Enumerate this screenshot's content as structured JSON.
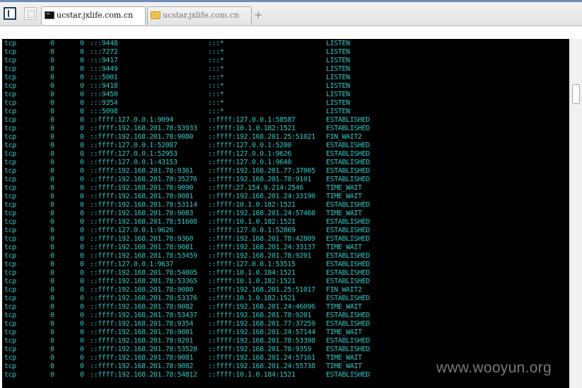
{
  "tabs": [
    {
      "label": "ucstar.jxlife.com.cn",
      "icon": "terminal-icon",
      "active": true
    },
    {
      "label": "ucstar.jxlife.com.cn",
      "icon": "folder-icon",
      "active": false
    }
  ],
  "new_tab_symbol": "+",
  "terminal": {
    "rows": [
      [
        "tcp",
        "0",
        "0",
        ":::9448",
        ":::*",
        "LISTEN"
      ],
      [
        "tcp",
        "0",
        "0",
        ":::7272",
        ":::*",
        "LISTEN"
      ],
      [
        "tcp",
        "0",
        "0",
        ":::9417",
        ":::*",
        "LISTEN"
      ],
      [
        "tcp",
        "0",
        "0",
        ":::9449",
        ":::*",
        "LISTEN"
      ],
      [
        "tcp",
        "0",
        "0",
        ":::5001",
        ":::*",
        "LISTEN"
      ],
      [
        "tcp",
        "0",
        "0",
        ":::9418",
        ":::*",
        "LISTEN"
      ],
      [
        "tcp",
        "0",
        "0",
        ":::9450",
        ":::*",
        "LISTEN"
      ],
      [
        "tcp",
        "0",
        "0",
        ":::9354",
        ":::*",
        "LISTEN"
      ],
      [
        "tcp",
        "0",
        "0",
        ":::5098",
        ":::*",
        "LISTEN"
      ],
      [
        "tcp",
        "0",
        "0",
        "::ffff:127.0.0.1:9094",
        "::ffff:127.0.0.1:58587",
        "ESTABLISHED"
      ],
      [
        "tcp",
        "0",
        "0",
        "::ffff:192.168.201.78:53933",
        "::ffff:10.1.0.182:1521",
        "ESTABLISHED"
      ],
      [
        "tcp",
        "0",
        "0",
        "::ffff:192.168.201.78:9080",
        "::ffff:192.168.201.25:51021",
        "FIN_WAIT2"
      ],
      [
        "tcp",
        "0",
        "0",
        "::ffff:127.0.0.1:52087",
        "::ffff:127.0.0.1:5200",
        "ESTABLISHED"
      ],
      [
        "tcp",
        "0",
        "0",
        "::ffff:127.0.0.1:52953",
        "::ffff:127.0.0.1:9626",
        "ESTABLISHED"
      ],
      [
        "tcp",
        "0",
        "0",
        "::ffff:127.0.0.1:43153",
        "::ffff:127.0.0.1:9640",
        "ESTABLISHED"
      ],
      [
        "tcp",
        "0",
        "0",
        "::ffff:192.168.201.78:9361",
        "::ffff:192.168.201.77:37005",
        "ESTABLISHED"
      ],
      [
        "tcp",
        "0",
        "0",
        "::ffff:192.168.201.78:35276",
        "::ffff:192.168.201.78:9101",
        "ESTABLISHED"
      ],
      [
        "tcp",
        "0",
        "0",
        "::ffff:192.168.201.78:9090",
        "::ffff:27.154.9.214:2546",
        "TIME_WAIT"
      ],
      [
        "tcp",
        "0",
        "0",
        "::ffff:192.168.201.78:9081",
        "::ffff:192.168.201.24:33190",
        "TIME_WAIT"
      ],
      [
        "tcp",
        "0",
        "0",
        "::ffff:192.168.201.78:53114",
        "::ffff:10.1.0.182:1521",
        "ESTABLISHED"
      ],
      [
        "tcp",
        "0",
        "0",
        "::ffff:192.168.201.78:9083",
        "::ffff:192.168.201.24:57468",
        "TIME_WAIT"
      ],
      [
        "tcp",
        "0",
        "0",
        "::ffff:192.168.201.78:51608",
        "::ffff:10.1.0.182:1521",
        "ESTABLISHED"
      ],
      [
        "tcp",
        "0",
        "0",
        "::ffff:127.0.0.1:9626",
        "::ffff:127.0.0.1:52869",
        "ESTABLISHED"
      ],
      [
        "tcp",
        "0",
        "0",
        "::ffff:192.168.201.78:9360",
        "::ffff:192.168.201.78:42809",
        "ESTABLISHED"
      ],
      [
        "tcp",
        "0",
        "0",
        "::ffff:192.168.201.78:9081",
        "::ffff:192.168.201.24:33137",
        "TIME_WAIT"
      ],
      [
        "tcp",
        "0",
        "0",
        "::ffff:192.168.201.78:53459",
        "::ffff:192.168.201.78:9201",
        "ESTABLISHED"
      ],
      [
        "tcp",
        "0",
        "0",
        "::ffff:127.0.0.1:9637",
        "::ffff:127.0.0.1:53515",
        "ESTABLISHED"
      ],
      [
        "tcp",
        "0",
        "0",
        "::ffff:192.168.201.78:54805",
        "::ffff:10.1.0.184:1521",
        "ESTABLISHED"
      ],
      [
        "tcp",
        "0",
        "0",
        "::ffff:192.168.201.78:53365",
        "::ffff:10.1.0.182:1521",
        "ESTABLISHED"
      ],
      [
        "tcp",
        "0",
        "0",
        "::ffff:192.168.201.78:9080",
        "::ffff:192.168.201.25:51017",
        "FIN_WAIT2"
      ],
      [
        "tcp",
        "0",
        "0",
        "::ffff:192.168.201.78:53376",
        "::ffff:10.1.0.182:1521",
        "ESTABLISHED"
      ],
      [
        "tcp",
        "0",
        "0",
        "::ffff:192.168.201.78:9082",
        "::ffff:192.168.201.24:46096",
        "TIME_WAIT"
      ],
      [
        "tcp",
        "0",
        "0",
        "::ffff:192.168.201.78:53437",
        "::ffff:192.168.201.78:9201",
        "ESTABLISHED"
      ],
      [
        "tcp",
        "0",
        "0",
        "::ffff:192.168.201.78:9354",
        "::ffff:192.168.201.77:37259",
        "ESTABLISHED"
      ],
      [
        "tcp",
        "0",
        "0",
        "::ffff:192.168.201.78:9081",
        "::ffff:192.168.201.24:57144",
        "TIME_WAIT"
      ],
      [
        "tcp",
        "0",
        "0",
        "::ffff:192.168.201.78:9201",
        "::ffff:192.168.201.78:53398",
        "ESTABLISHED"
      ],
      [
        "tcp",
        "0",
        "0",
        "::ffff:192.168.201.78:53520",
        "::ffff:192.168.201.78:9359",
        "ESTABLISHED"
      ],
      [
        "tcp",
        "0",
        "0",
        "::ffff:192.168.201.78:9081",
        "::ffff:192.168.201.24:57161",
        "TIME_WAIT"
      ],
      [
        "tcp",
        "0",
        "0",
        "::ffff:192.168.201.78:9082",
        "::ffff:192.168.201.24:55738",
        "TIME_WAIT"
      ],
      [
        "tcp",
        "0",
        "0",
        "::ffff:192.168.201.78:54812",
        "::ffff:10.1.0.184:1521",
        "ESTABLISHED"
      ]
    ]
  },
  "watermark": "www.wooyun.org",
  "colors": {
    "terminal_background": "#000000",
    "terminal_text": "#2fc7c4",
    "tabbar_accent": "#6d8fb6"
  }
}
